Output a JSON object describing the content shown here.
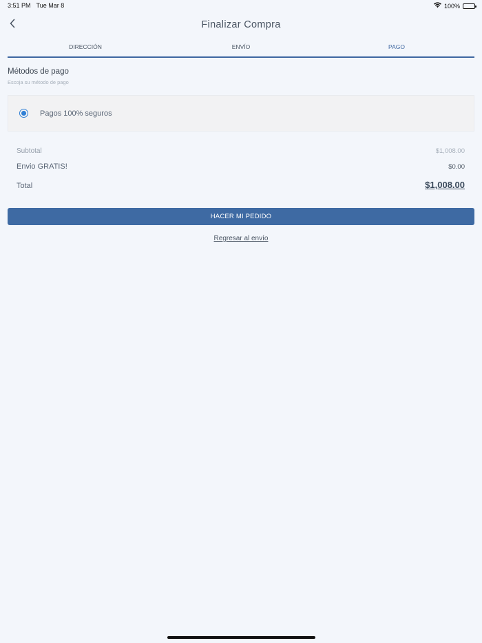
{
  "status_bar": {
    "time": "3:51 PM",
    "date": "Tue Mar 8",
    "battery": "100%",
    "icons": [
      "wifi-icon",
      "battery-icon"
    ]
  },
  "header": {
    "back_icon": "chevron-left-icon",
    "title": "Finalizar Compra"
  },
  "tabs": [
    {
      "label": "DIRECCIÓN",
      "active": false
    },
    {
      "label": "ENVÍO",
      "active": false
    },
    {
      "label": "PAGO",
      "active": true
    }
  ],
  "payment": {
    "title": "Métodos de pago",
    "subtitle": "Escoja su método de pago",
    "option_label": "Pagos 100% seguros",
    "selected": true
  },
  "summary": {
    "subtotal_label": "Subtotal",
    "subtotal_value": "$1,008.00",
    "shipping_label": "Envio GRATIS!",
    "shipping_value": "$0.00",
    "total_label": "Total",
    "total_value": "$1,008.00"
  },
  "actions": {
    "order_button": "HACER MI PEDIDO",
    "back_link": "Regresar al envío"
  },
  "colors": {
    "accent": "#3e6aa3",
    "radio": "#2f7fd5",
    "background": "#f3f6fb"
  }
}
